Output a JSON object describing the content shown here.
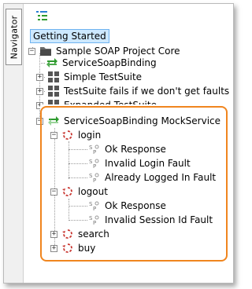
{
  "navigator_tab": {
    "label": "Navigator"
  },
  "toolbar": {
    "tree_view_icon": "tree-view-icon"
  },
  "project_title": "Getting Started",
  "tree": {
    "project": {
      "label": "Sample SOAP Project Core",
      "icon": "folder-icon"
    },
    "items": [
      {
        "label": "ServiceSoapBinding",
        "icon": "interface-arrows-icon"
      },
      {
        "label": "Simple TestSuite",
        "icon": "testsuite-grid-icon"
      },
      {
        "label": "TestSuite fails if we don't get faults",
        "icon": "testsuite-grid-icon"
      },
      {
        "label": "Expanded TestSuite",
        "icon": "testsuite-grid-icon"
      }
    ],
    "mock_service": {
      "label": "ServiceSoapBinding MockService",
      "icon": "mock-service-icon",
      "operations": [
        {
          "label": "login",
          "icon": "mock-operation-icon",
          "responses": [
            "Ok Response",
            "Invalid Login Fault",
            "Already Logged In Fault"
          ]
        },
        {
          "label": "logout",
          "icon": "mock-operation-icon",
          "responses": [
            "Ok Response",
            "Invalid Session Id Fault"
          ]
        },
        {
          "label": "search",
          "icon": "mock-operation-icon",
          "responses": []
        },
        {
          "label": "buy",
          "icon": "mock-operation-icon",
          "responses": []
        }
      ]
    }
  },
  "colors": {
    "highlight": "#f0851e",
    "selection": "#cde8ff",
    "green": "#2e9b2e",
    "red": "#c8352f"
  }
}
